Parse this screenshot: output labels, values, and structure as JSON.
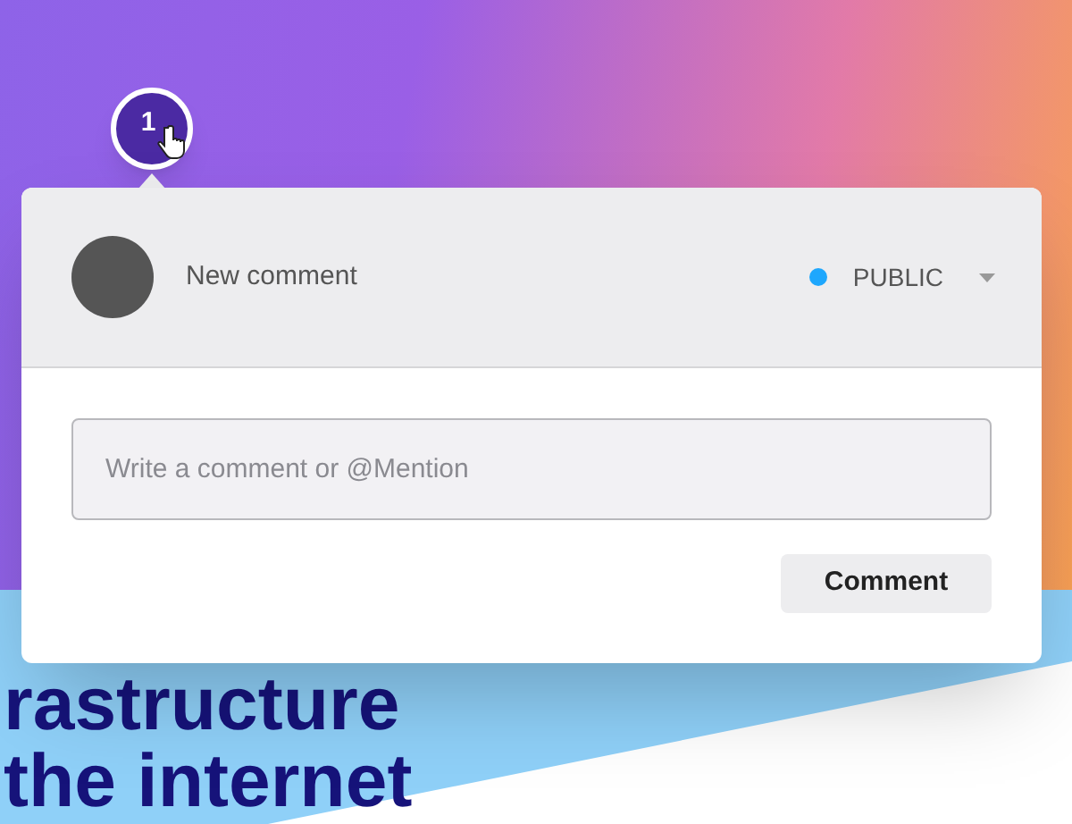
{
  "background_heading": [
    "rastructure",
    "the internet"
  ],
  "marker": {
    "number": "1"
  },
  "comment_card": {
    "title": "New comment",
    "visibility": "PUBLIC",
    "input": {
      "placeholder": "Write a comment or @Mention"
    },
    "submit_button": "Comment"
  }
}
